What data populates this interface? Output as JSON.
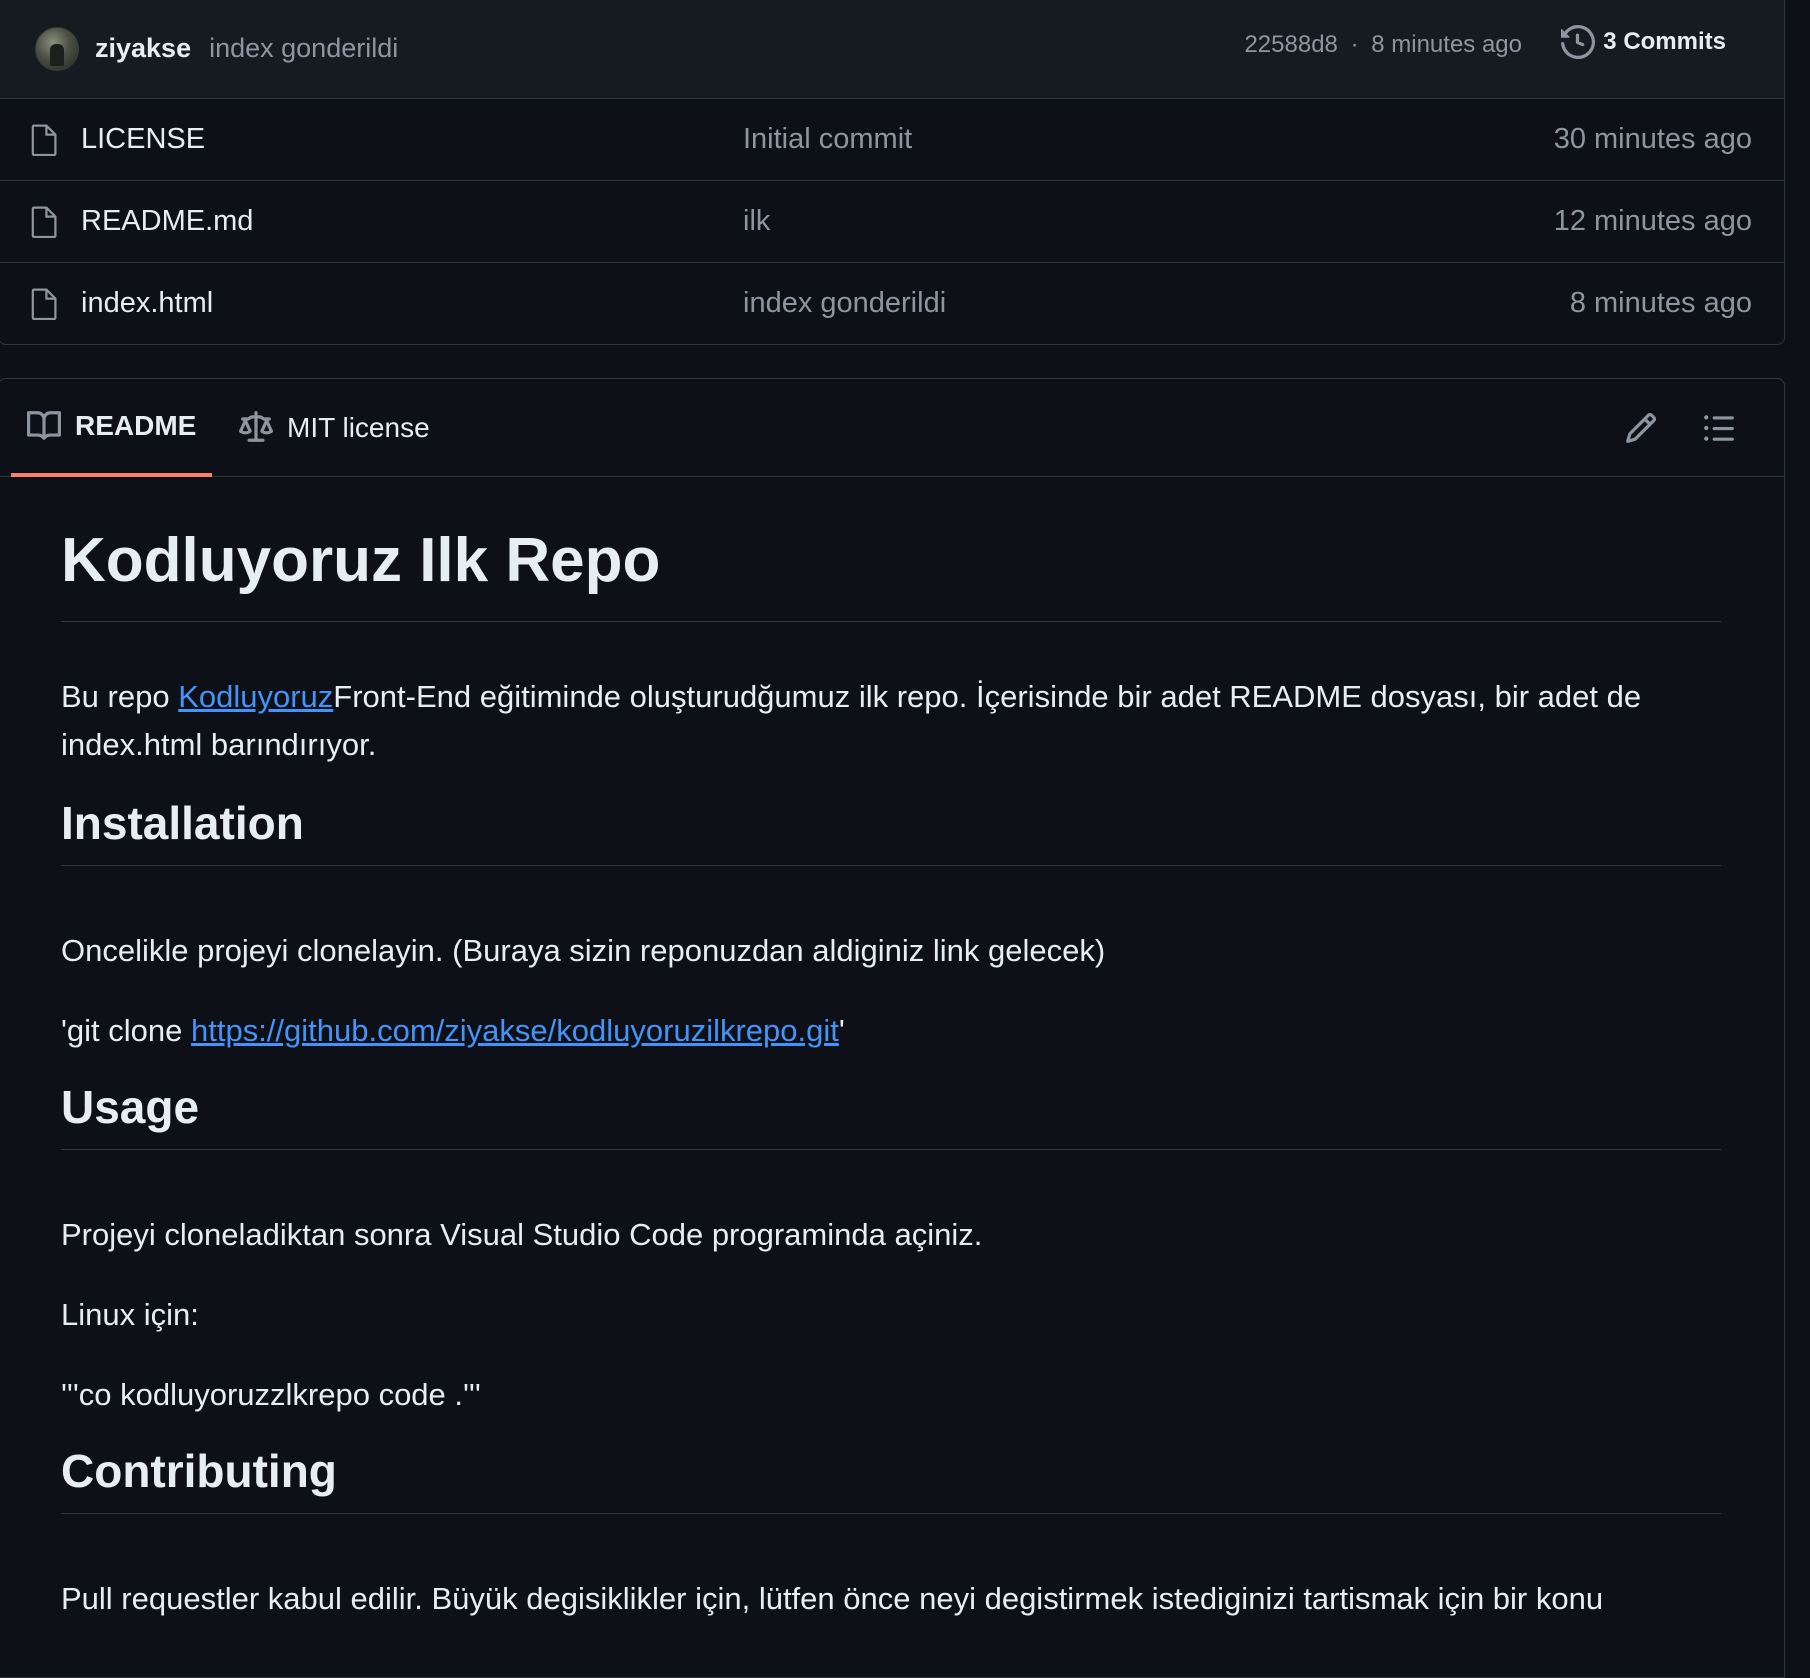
{
  "commit_bar": {
    "author": "ziyakse",
    "message": "index gonderildi",
    "hash": "22588d8",
    "separator": "·",
    "time": "8 minutes ago",
    "commits_label": "3 Commits"
  },
  "files": [
    {
      "name": "LICENSE",
      "commit": "Initial commit",
      "time": "30 minutes ago",
      "icon": "file-icon"
    },
    {
      "name": "README.md",
      "commit": "ilk",
      "time": "12 minutes ago",
      "icon": "file-icon"
    },
    {
      "name": "index.html",
      "commit": "index gonderildi",
      "time": "8 minutes ago",
      "icon": "file-icon"
    }
  ],
  "readme_tabs": {
    "readme_label": "README",
    "license_label": "MIT license",
    "active_tab_color": "#f78166"
  },
  "readme": {
    "title": "Kodluyoruz Ilk Repo",
    "intro_prefix": "Bu repo ",
    "intro_link": "Kodluyoruz",
    "intro_rest": "Front-End eğitiminde oluşturudğumuz ilk repo. İçerisinde bir adet README dosyası, bir adet de index.html barındırıyor.",
    "installation_heading": "Installation",
    "installation_text": "Oncelikle projeyi clonelayin. (Buraya sizin reponuzdan aldiginiz link gelecek)",
    "clone_prefix": "'git clone ",
    "clone_link": "https://github.com/ziyakse/kodluyoruzilkrepo.git",
    "clone_suffix": "'",
    "usage_heading": "Usage",
    "usage_text": "Projeyi cloneladiktan sonra Visual Studio Code programinda açiniz.",
    "linux_label": "Linux için:",
    "linux_command": "'''co kodluyoruzzlkrepo code .'''",
    "contributing_heading": "Contributing",
    "contributing_text": "Pull requestler kabul edilir. Büyük degisiklikler için, lütfen önce neyi degistirmek istediginizi tartismak için bir konu"
  },
  "colors": {
    "background": "#0d1117",
    "link": "#4493f8",
    "muted": "#8d96a0",
    "border": "#30363d"
  }
}
